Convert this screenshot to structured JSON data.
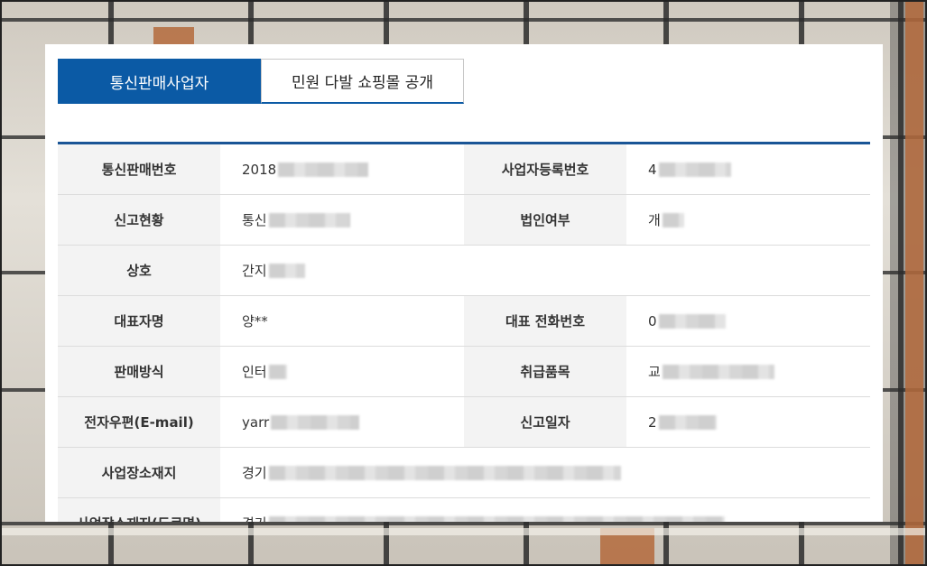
{
  "tabs": [
    {
      "label": "통신판매사업자",
      "active": true
    },
    {
      "label": "민원 다발 쇼핑몰 공개",
      "active": false
    }
  ],
  "rows": [
    {
      "h1": "통신판매번호",
      "v1": "2018",
      "h2": "사업자등록번호",
      "v2": "4"
    },
    {
      "h1": "신고현황",
      "v1": "통신",
      "h2": "법인여부",
      "v2": "개"
    },
    {
      "h1": "상호",
      "v1": "간지"
    },
    {
      "h1": "대표자명",
      "v1": "양**",
      "h2": "대표 전화번호",
      "v2": "0"
    },
    {
      "h1": "판매방식",
      "v1": "인터",
      "h2": "취급품목",
      "v2": "교"
    },
    {
      "h1": "전자우편(E-mail)",
      "v1": "yarr",
      "h2": "신고일자",
      "v2": "2"
    },
    {
      "h1": "사업장소재지",
      "v1": "경기"
    },
    {
      "h1": "사업장소재지(도로명)",
      "v1": "경기"
    }
  ],
  "colors": {
    "accent": "#0b5aa5",
    "header_bg": "#f3f3f3"
  }
}
